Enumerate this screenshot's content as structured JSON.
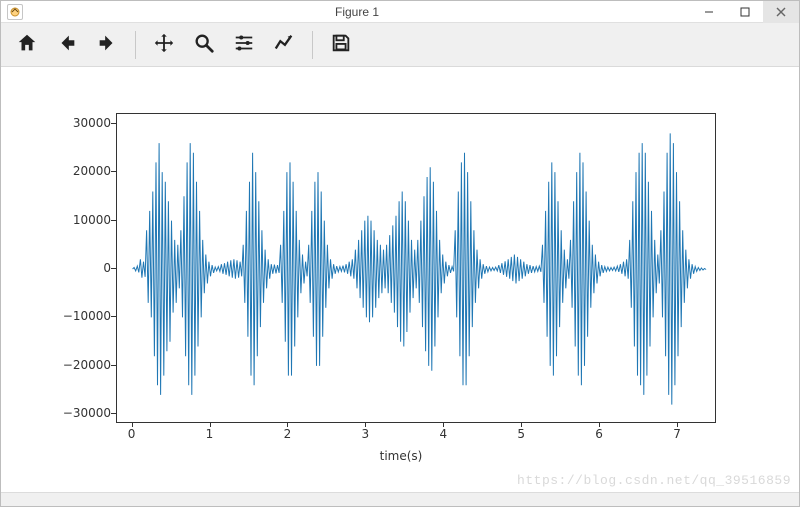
{
  "window": {
    "title": "Figure 1",
    "minimize_tip": "Minimize",
    "maximize_tip": "Maximize",
    "close_tip": "Close"
  },
  "toolbar": {
    "home": "Home",
    "back": "Back",
    "forward": "Forward",
    "pan": "Pan",
    "zoom": "Zoom",
    "subplots": "Configure subplots",
    "edit": "Edit axis",
    "save": "Save"
  },
  "watermark": "https://blog.csdn.net/qq_39516859",
  "chart_data": {
    "type": "line",
    "title": "",
    "xlabel": "time(s)",
    "ylabel": "",
    "xlim": [
      -0.2,
      7.5
    ],
    "ylim": [
      -32000,
      32000
    ],
    "xticks": [
      0,
      1,
      2,
      3,
      4,
      5,
      6,
      7
    ],
    "yticks": [
      -30000,
      -20000,
      -10000,
      0,
      10000,
      20000,
      30000
    ],
    "series": [
      {
        "name": "waveform",
        "color": "#1f77b4",
        "x_step": 0.02,
        "values": [
          0,
          300,
          -400,
          600,
          -700,
          2000,
          -1800,
          1500,
          -1600,
          8000,
          -7000,
          12000,
          -10000,
          16000,
          -18000,
          22000,
          -24000,
          26000,
          -26000,
          20000,
          -22000,
          18000,
          -17000,
          14000,
          -15000,
          10000,
          -9000,
          6000,
          -7000,
          5000,
          -4000,
          8000,
          -10000,
          15000,
          -18000,
          22000,
          -24000,
          26000,
          -26000,
          24000,
          -22000,
          18000,
          -16000,
          12000,
          -10000,
          6000,
          -5000,
          3000,
          -3000,
          1500,
          -1500,
          800,
          -800,
          400,
          -400,
          500,
          -500,
          1000,
          -1000,
          1200,
          -1200,
          1500,
          -1500,
          1800,
          -1800,
          2000,
          -2000,
          1800,
          -1800,
          1500,
          -1500,
          5000,
          -7000,
          12000,
          -14000,
          18000,
          -22000,
          24000,
          -24000,
          20000,
          -18000,
          14000,
          -12000,
          8000,
          -7000,
          4000,
          -4000,
          2000,
          -2000,
          1000,
          -1000,
          900,
          -900,
          800,
          -800,
          5000,
          -7000,
          12000,
          -15000,
          20000,
          -22000,
          22000,
          -22000,
          18000,
          -16000,
          12000,
          -10000,
          6000,
          -5000,
          3000,
          -3000,
          1500,
          -1500,
          5000,
          -7000,
          12000,
          -14000,
          18000,
          -20000,
          20000,
          -20000,
          16000,
          -14000,
          10000,
          -8000,
          5000,
          -4000,
          2000,
          -2000,
          1000,
          -1000,
          600,
          -600,
          500,
          -500,
          700,
          -700,
          1000,
          -1000,
          1500,
          -1500,
          2000,
          -2000,
          4000,
          -4000,
          6000,
          -6000,
          8000,
          -8000,
          10000,
          -10000,
          11000,
          -11000,
          10000,
          -10000,
          8000,
          -8000,
          6000,
          -6000,
          5000,
          -5000,
          4000,
          -4000,
          5000,
          -5000,
          7000,
          -7000,
          9000,
          -9000,
          11000,
          -12000,
          14000,
          -15000,
          16000,
          -16000,
          14000,
          -13000,
          10000,
          -9000,
          6000,
          -6000,
          4000,
          -4000,
          6000,
          -7000,
          10000,
          -12000,
          15000,
          -17000,
          19000,
          -20000,
          21000,
          -21000,
          18000,
          -16000,
          12000,
          -10000,
          6000,
          -5000,
          3000,
          -3000,
          1500,
          -1500,
          800,
          -800,
          500,
          -500,
          8000,
          -10000,
          16000,
          -18000,
          22000,
          -24000,
          24000,
          -24000,
          20000,
          -18000,
          14000,
          -12000,
          8000,
          -7000,
          4000,
          -4000,
          2000,
          -2000,
          1000,
          -1000,
          600,
          -600,
          400,
          -400,
          300,
          -300,
          400,
          -400,
          800,
          -800,
          1200,
          -1200,
          1600,
          -1600,
          2000,
          -2000,
          2500,
          -2500,
          3000,
          -3000,
          2500,
          -2500,
          2000,
          -2000,
          1500,
          -1500,
          1000,
          -1000,
          800,
          -800,
          600,
          -600,
          500,
          -500,
          600,
          -600,
          5000,
          -7000,
          12000,
          -14000,
          18000,
          -20000,
          22000,
          -22000,
          20000,
          -18000,
          14000,
          -12000,
          8000,
          -7000,
          4000,
          -4000,
          2000,
          -2000,
          6000,
          -8000,
          14000,
          -16000,
          20000,
          -22000,
          24000,
          -24000,
          22000,
          -20000,
          16000,
          -14000,
          10000,
          -8000,
          5000,
          -5000,
          3000,
          -3000,
          1500,
          -1500,
          800,
          -800,
          500,
          -500,
          400,
          -400,
          300,
          -300,
          400,
          -400,
          600,
          -600,
          1000,
          -1000,
          1500,
          -1500,
          2000,
          -2000,
          6000,
          -8000,
          14000,
          -16000,
          20000,
          -22000,
          24000,
          -24000,
          26000,
          -26000,
          24000,
          -22000,
          18000,
          -16000,
          12000,
          -10000,
          6000,
          -5000,
          3000,
          -3000,
          8000,
          -10000,
          16000,
          -18000,
          24000,
          -26000,
          28000,
          -28000,
          26000,
          -24000,
          20000,
          -18000,
          14000,
          -12000,
          8000,
          -7000,
          4000,
          -4000,
          2000,
          -2000,
          1000,
          -1000,
          500,
          -500,
          300,
          -300,
          200,
          -200,
          100,
          -100
        ]
      }
    ]
  }
}
